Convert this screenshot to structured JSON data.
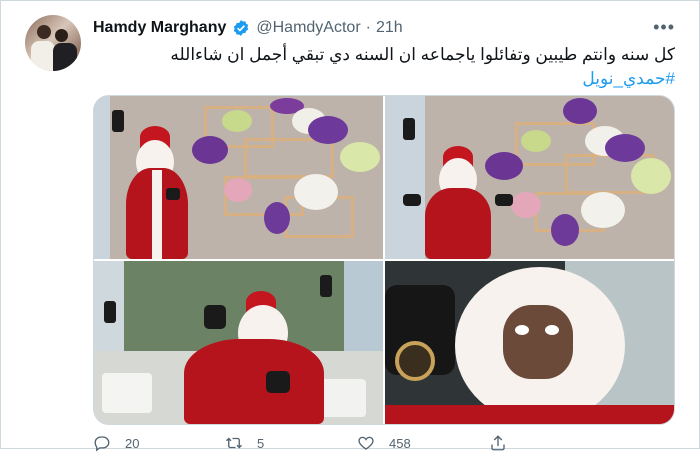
{
  "tweet": {
    "author_name": "Hamdy Marghany",
    "handle": "@HamdyActor",
    "separator": "·",
    "time": "21h",
    "more_label": "•••",
    "text": "كل سنه وانتم طيبين وتفائلوا ياجماعه ان السنه دي تبقي أجمل ان شاءالله",
    "hashtag": "#حمدي_نويل"
  },
  "actions": {
    "replies": "20",
    "retweets": "5",
    "likes": "458"
  },
  "colors": {
    "accent": "#1d9bf0",
    "muted": "#536471",
    "border": "#cfd9de"
  },
  "icons": [
    "verified-badge-icon",
    "more-icon",
    "reply-icon",
    "retweet-icon",
    "like-icon",
    "share-icon"
  ]
}
